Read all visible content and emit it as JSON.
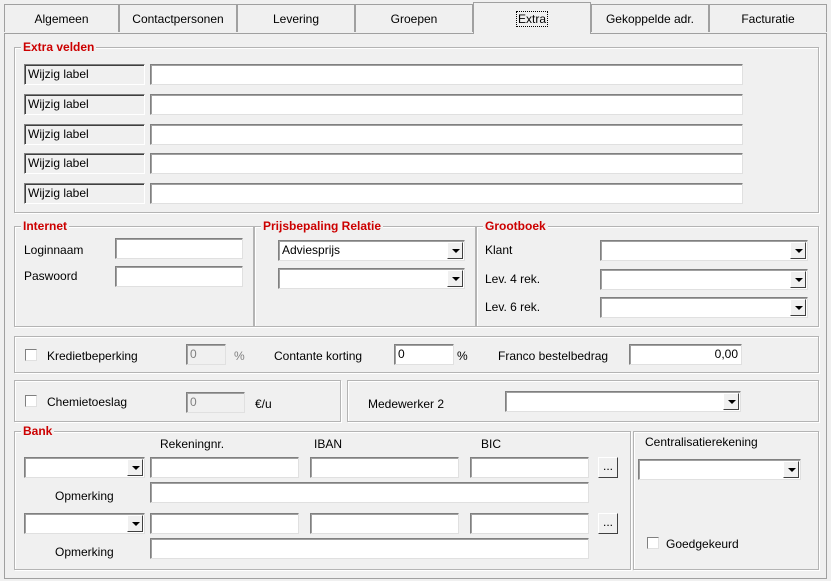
{
  "tabs": [
    "Algemeen",
    "Contactpersonen",
    "Levering",
    "Groepen",
    "Extra",
    "Gekoppelde adr.",
    "Facturatie"
  ],
  "extra_velden": {
    "legend": "Extra velden",
    "labels": [
      "Wijzig label",
      "Wijzig label",
      "Wijzig label",
      "Wijzig label",
      "Wijzig label"
    ]
  },
  "internet": {
    "legend": "Internet",
    "login_label": "Loginnaam",
    "password_label": "Paswoord"
  },
  "prijs": {
    "legend": "Prijsbepaling Relatie",
    "combo1_value": "Adviesprijs"
  },
  "grootboek": {
    "legend": "Grootboek",
    "klant_label": "Klant",
    "lev4_label": "Lev. 4 rek.",
    "lev6_label": "Lev. 6 rek."
  },
  "krediet": {
    "check_label": "Kredietbeperking",
    "value": "0",
    "pct": "%",
    "contante_label": "Contante korting",
    "contante_value": "0",
    "contante_pct": "%",
    "franco_label": "Franco bestelbedrag",
    "franco_value": "0,00"
  },
  "chemie": {
    "check_label": "Chemietoeslag",
    "value": "0",
    "unit": "€/u"
  },
  "medewerker": {
    "label": "Medewerker 2"
  },
  "bank": {
    "legend": "Bank",
    "col_rekening": "Rekeningnr.",
    "col_iban": "IBAN",
    "col_bic": "BIC",
    "opmerking_label": "Opmerking",
    "ellipsis": "..."
  },
  "centralisatie": {
    "label": "Centralisatierekening",
    "goedgekeurd_label": "Goedgekeurd"
  }
}
